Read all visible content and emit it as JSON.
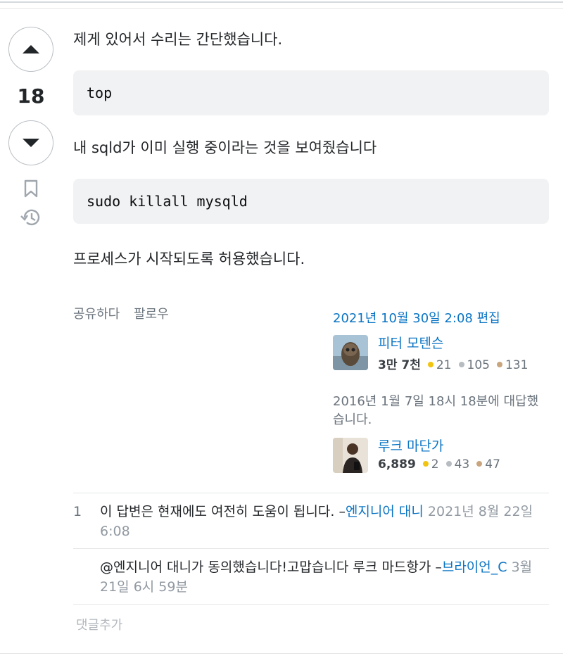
{
  "vote": {
    "count": "18"
  },
  "answer": {
    "para1": "제게 있어서 수리는 간단했습니다.",
    "code1": "top",
    "para2": "내 sqld가 이미 실행 중이라는 것을 보여줬습니다",
    "code2": "sudo killall mysqld",
    "para3": "프로세스가 시작되도록 허용했습니다."
  },
  "menu": {
    "share": "공유하다",
    "follow": "팔로우"
  },
  "edit": {
    "label": "2021년 10월 30일 2:08 편집",
    "user": "피터 모텐슨",
    "rep": "3만 7천",
    "gold": "21",
    "silver": "105",
    "bronze": "131"
  },
  "answered": {
    "label": "2016년 1월 7일 18시 18분에 대답했습니다.",
    "user": "루크 마단가",
    "rep": "6,889",
    "gold": "2",
    "silver": "43",
    "bronze": "47"
  },
  "comments": [
    {
      "score": "1",
      "text": "이 답변은 현재에도 여전히 도움이 됩니다. –",
      "user": "엔지니어 대니",
      "date": "2021년 8월 22일 6:08"
    },
    {
      "score": "",
      "text": "@엔지니어 대니가 동의했습니다!고맙습니다 루크 마드항가 –",
      "user": "브라이언_C",
      "date": "3월 21일 6시 59분"
    }
  ],
  "add_comment": "댓글추가",
  "colors": {
    "link": "#0a74c4",
    "gold": "#f1c40f",
    "silver": "#b7bcc1",
    "bronze": "#c9a57e"
  }
}
